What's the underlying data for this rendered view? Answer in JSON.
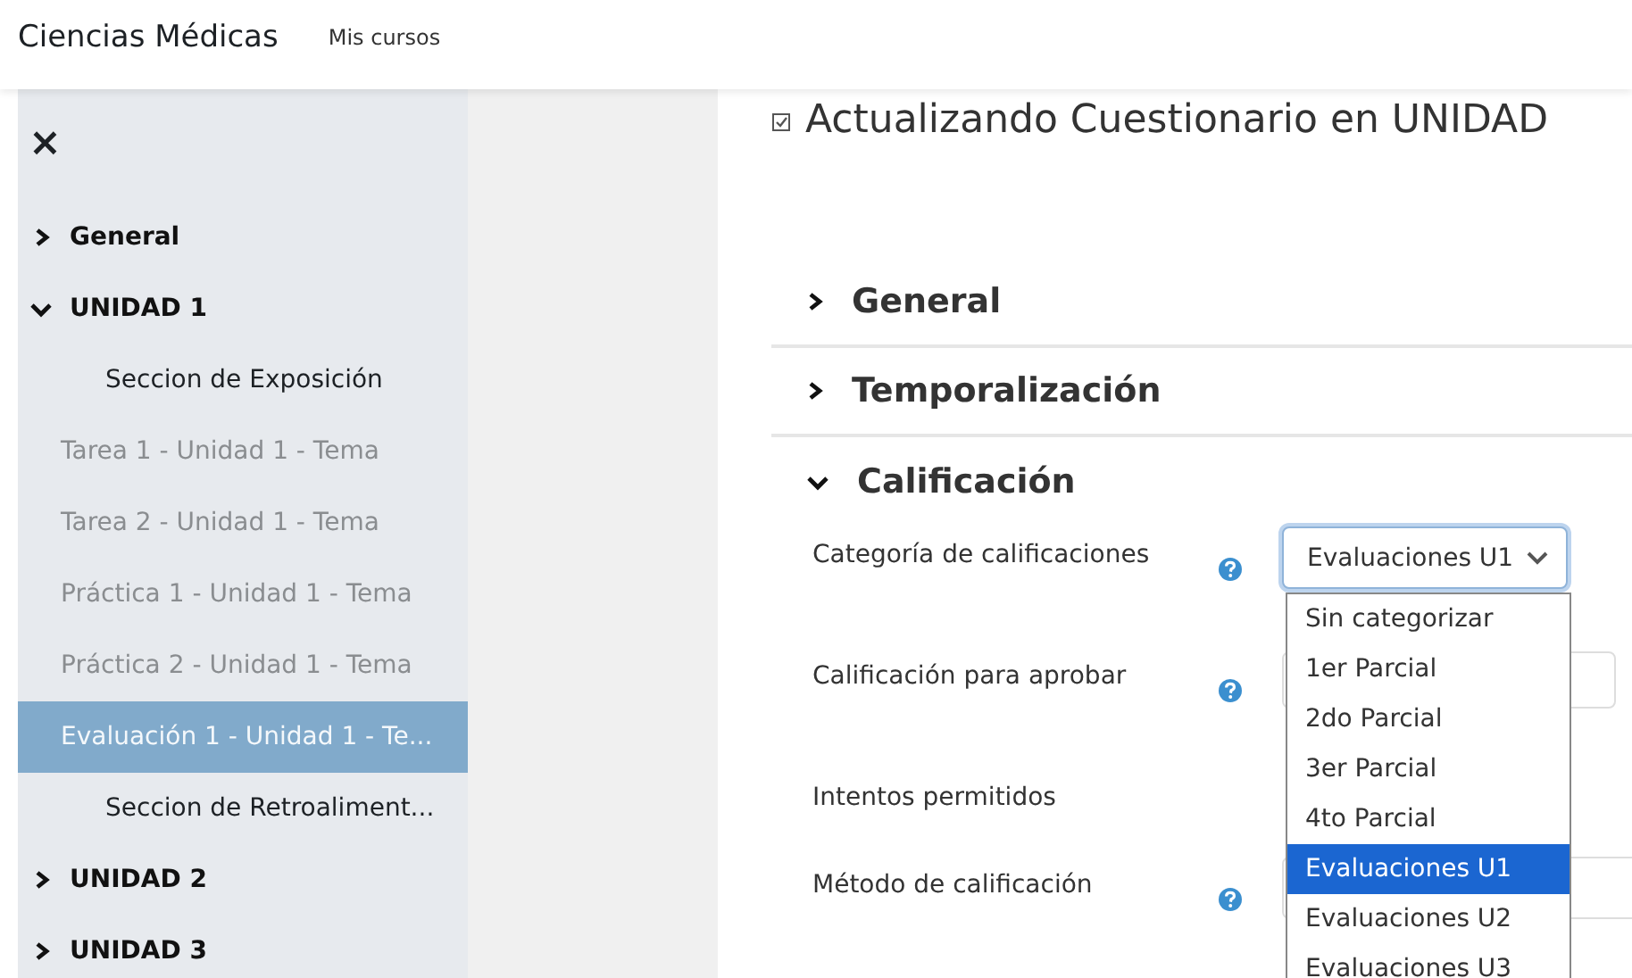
{
  "header": {
    "site_name": "Ciencias Médicas",
    "nav_link": "Mis cursos"
  },
  "sidebar": {
    "close": "×",
    "items": [
      {
        "kind": "section",
        "label": "General",
        "expanded": false,
        "selected": false
      },
      {
        "kind": "section",
        "label": "UNIDAD 1",
        "expanded": true,
        "selected": false,
        "children": [
          {
            "kind": "label",
            "label": "Seccion de Exposición",
            "selected": false
          },
          {
            "kind": "activity",
            "label": "Tarea 1 - Unidad 1 - Tema",
            "selected": false
          },
          {
            "kind": "activity",
            "label": "Tarea 2 - Unidad 1 - Tema",
            "selected": false
          },
          {
            "kind": "activity",
            "label": "Práctica 1 - Unidad 1 - Tema",
            "selected": false
          },
          {
            "kind": "activity",
            "label": "Práctica 2 - Unidad 1 - Tema",
            "selected": false
          },
          {
            "kind": "activity",
            "label": "Evaluación 1 - Unidad 1 - Te...",
            "selected": true
          },
          {
            "kind": "label",
            "label": "Seccion de Retroaliment...",
            "selected": false
          }
        ]
      },
      {
        "kind": "section",
        "label": "UNIDAD 2",
        "expanded": false,
        "selected": false
      },
      {
        "kind": "section",
        "label": "UNIDAD 3",
        "expanded": false,
        "selected": false
      }
    ]
  },
  "page": {
    "title": "Actualizando Cuestionario en UNIDAD",
    "sections": [
      {
        "title": "General",
        "expanded": false
      },
      {
        "title": "Temporalización",
        "expanded": false
      },
      {
        "title": "Calificación",
        "expanded": true,
        "fields": [
          {
            "label": "Categoría de calificaciones",
            "help": true,
            "kind": "select",
            "value": "Evaluaciones U1",
            "open": true,
            "options": [
              {
                "label": "Sin categorizar",
                "selected": false
              },
              {
                "label": "1er Parcial",
                "selected": false
              },
              {
                "label": "2do Parcial",
                "selected": false
              },
              {
                "label": "3er Parcial",
                "selected": false
              },
              {
                "label": "4to Parcial",
                "selected": false
              },
              {
                "label": "Evaluaciones U1",
                "selected": true
              },
              {
                "label": "Evaluaciones U2",
                "selected": false
              },
              {
                "label": "Evaluaciones U3",
                "selected": false
              }
            ]
          },
          {
            "label": "Calificación para aprobar",
            "help": true,
            "kind": "input"
          },
          {
            "label": "Intentos permitidos",
            "help": false,
            "kind": "hidden"
          },
          {
            "label": "Método de calificación",
            "help": true,
            "kind": "select-covered"
          }
        ]
      }
    ]
  }
}
